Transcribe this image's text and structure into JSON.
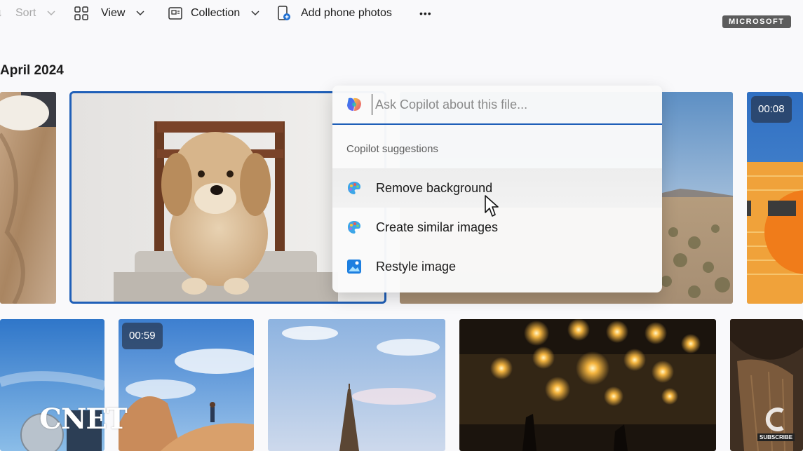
{
  "toolbar": {
    "sort_label": "Sort",
    "view_label": "View",
    "collection_label": "Collection",
    "add_phone_label": "Add phone photos",
    "more_label": "•••"
  },
  "badge": "MICROSOFT",
  "gallery": {
    "date_heading": "April 2024",
    "durations": {
      "video_top_right": "00:08",
      "video_bottom": "00:59"
    }
  },
  "copilot": {
    "placeholder": "Ask Copilot about this file...",
    "suggestions_heading": "Copilot suggestions",
    "suggestions": [
      {
        "label": "Remove background",
        "icon": "paint-palette-icon"
      },
      {
        "label": "Create similar images",
        "icon": "paint-palette-icon"
      },
      {
        "label": "Restyle image",
        "icon": "image-restyle-icon"
      }
    ]
  },
  "watermark": {
    "brand": "CNET",
    "subscribe": "SUBSCRIBE"
  },
  "colors": {
    "accent": "#1f5fb8",
    "badge_bg": "#5c5c5c"
  }
}
